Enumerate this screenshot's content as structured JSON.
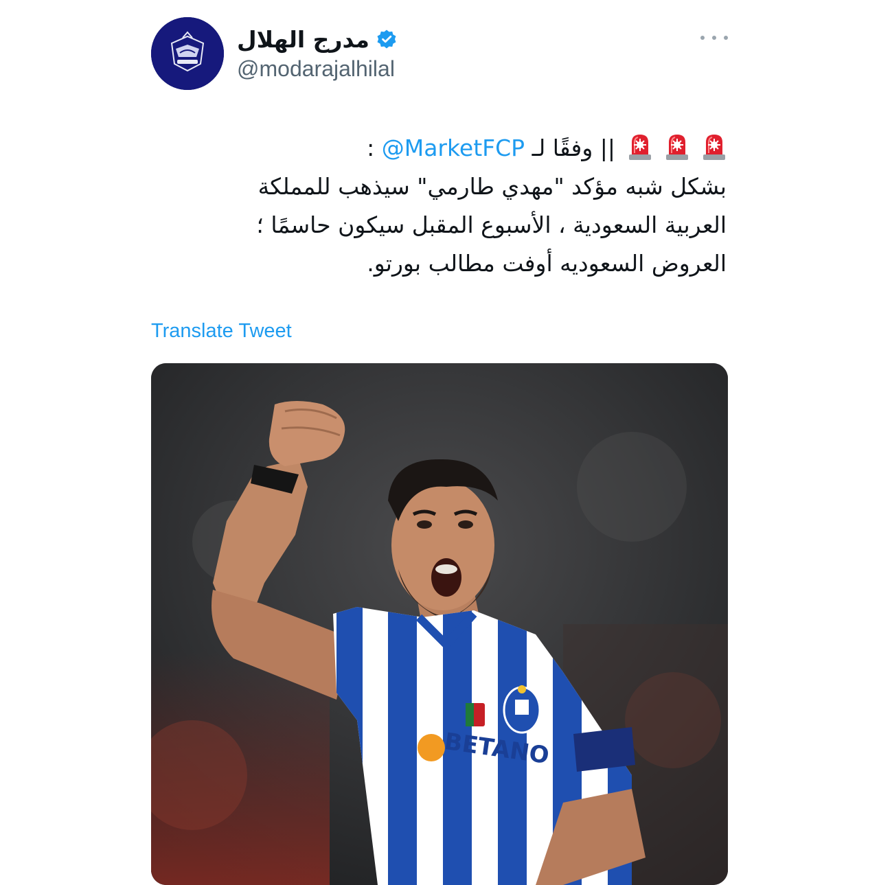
{
  "author": {
    "display_name": "مدرج الهلال",
    "handle": "@modarajalhilal",
    "verified": true,
    "avatar_icon": "club-logo-avatar"
  },
  "more_icon": "more-dots-icon",
  "tweet": {
    "line1_mention": "@MarketFCP",
    "line1_colon": ": ",
    "line1_prefix": " وفقًا لـ",
    "line1_separator": "|| ",
    "siren_icon": "police-siren-emoji",
    "line2": "بشكل شبه مؤكد \"مهدي طارمي\" سيذهب للمملكة",
    "line3": "العربية السعودية ، الأسبوع المقبل سيكون حاسمًا ؛",
    "line4": "العروض السعوديه أوفت مطالب بورتو."
  },
  "translate_label": "Translate Tweet",
  "media": {
    "description_icon": "tweet-photo",
    "jersey_sponsor": "BETANO"
  },
  "colors": {
    "accent": "#1d9bf0",
    "text": "#0f1419",
    "secondary": "#536471",
    "verified": "#1d9bf0"
  }
}
